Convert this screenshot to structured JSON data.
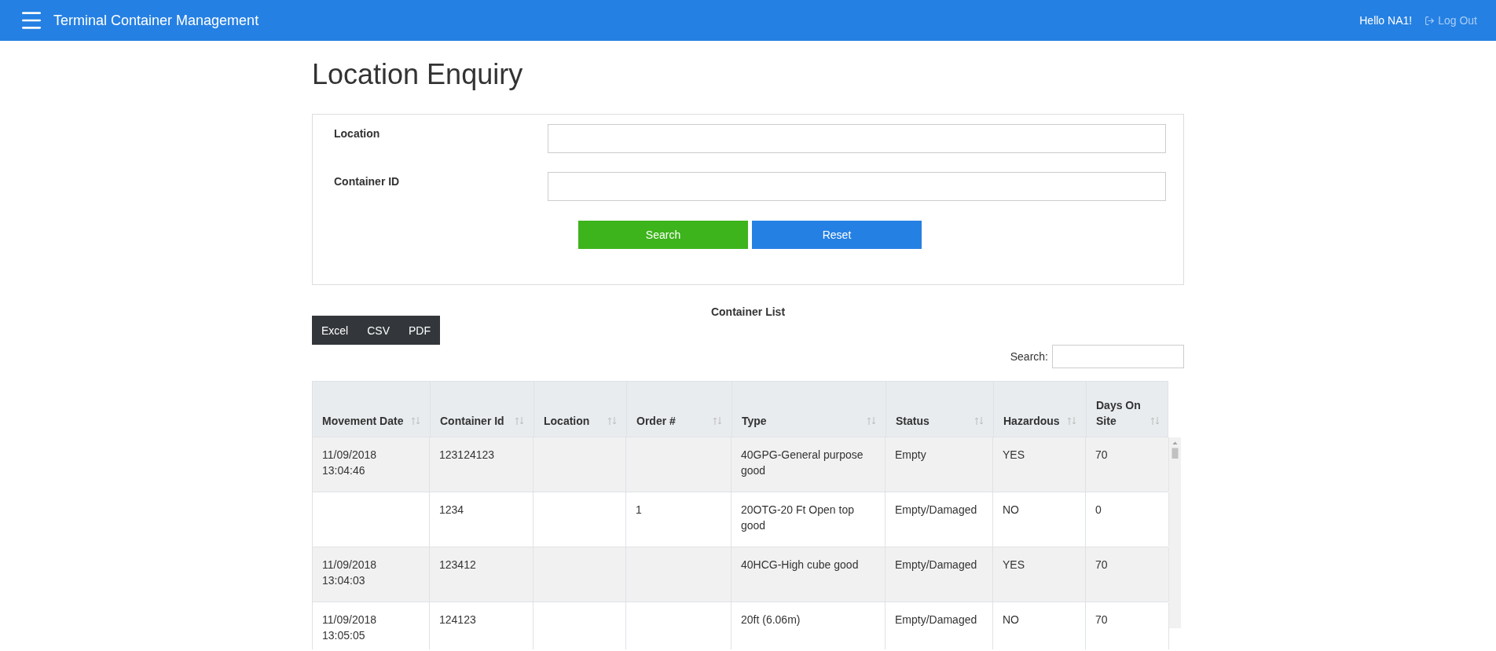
{
  "navbar": {
    "title": "Terminal Container Management",
    "greeting": "Hello NA1!",
    "logout": "Log Out"
  },
  "page_title": "Location Enquiry",
  "form": {
    "fields": [
      {
        "label": "Location"
      },
      {
        "label": "Container ID"
      }
    ],
    "buttons": [
      {
        "label": "Search",
        "kind": "primary"
      },
      {
        "label": "Reset",
        "kind": "secondary"
      }
    ]
  },
  "list_title": "Container List",
  "export_buttons": [
    "Excel",
    "CSV",
    "PDF"
  ],
  "table_search": {
    "label": "Search:"
  },
  "table": {
    "columns": [
      "Movement Date",
      "Container Id",
      "Location",
      "Order #",
      "Type",
      "Status",
      "Hazardous",
      "Days On Site"
    ],
    "rows": [
      [
        "11/09/2018 13:04:46",
        "123124123",
        "",
        "",
        "40GPG-General purpose good",
        "Empty",
        "YES",
        "70"
      ],
      [
        "",
        "1234",
        "",
        "1",
        "20OTG-20 Ft Open top good",
        "Empty/Damaged",
        "NO",
        "0"
      ],
      [
        "11/09/2018 13:04:03",
        "123412",
        "",
        "",
        "40HCG-High cube good",
        "Empty/Damaged",
        "YES",
        "70"
      ],
      [
        "11/09/2018 13:05:05",
        "124123",
        "",
        "",
        "20ft (6.06m)",
        "Empty/Damaged",
        "NO",
        "70"
      ]
    ]
  }
}
